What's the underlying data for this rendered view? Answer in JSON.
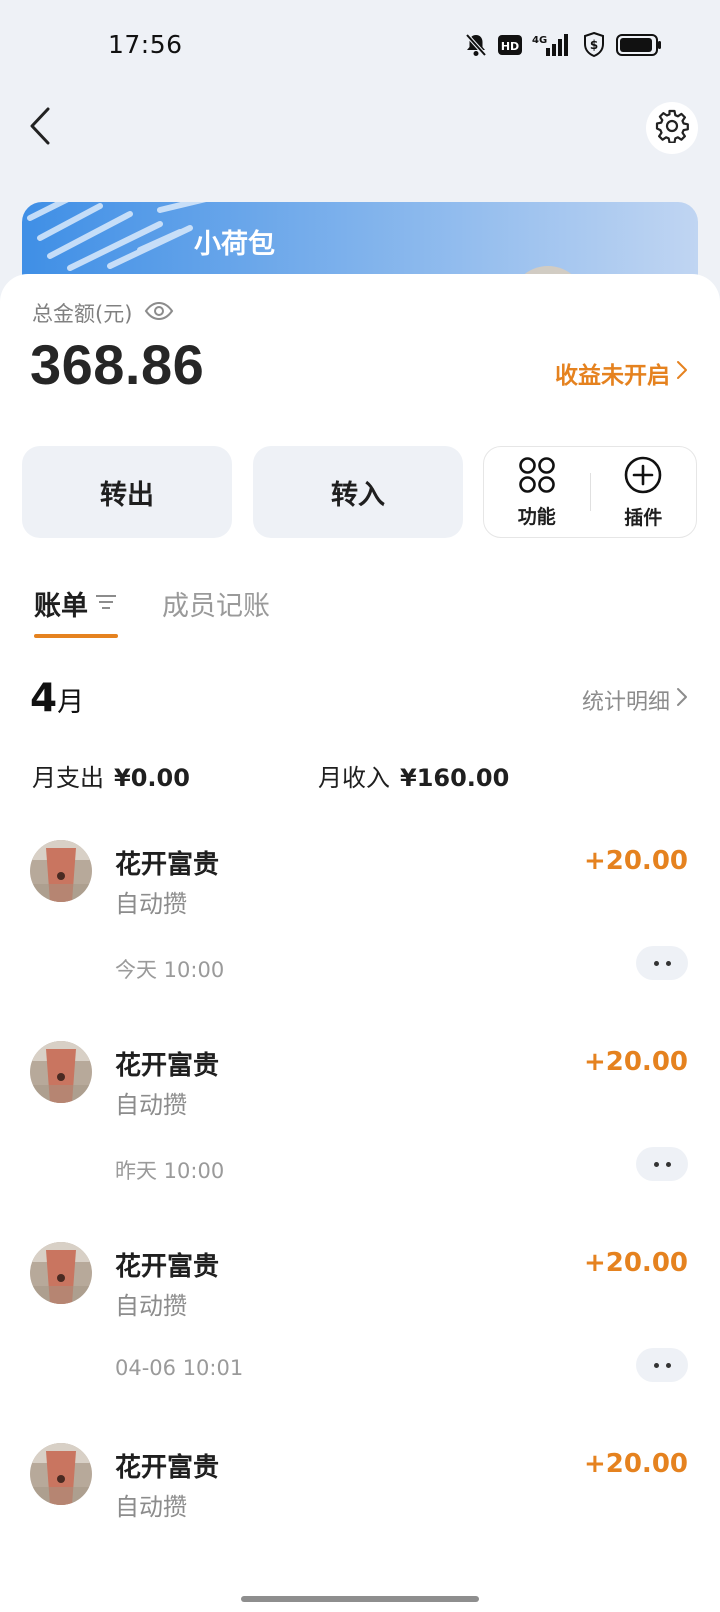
{
  "status_bar": {
    "time": "17:56",
    "network": "4G"
  },
  "header": {
    "back_icon": "chevron-left-icon",
    "settings_icon": "gear-icon"
  },
  "wallet": {
    "name": "小荷包"
  },
  "balance": {
    "label": "总金额(元)",
    "amount": "368.86",
    "earnings_link": "收益未开启"
  },
  "actions": {
    "transfer_out": "转出",
    "transfer_in": "转入",
    "functions": "功能",
    "plugins": "插件"
  },
  "tabs": {
    "bills": "账单",
    "members": "成员记账"
  },
  "month": {
    "number": "4",
    "unit": "月",
    "stats_link": "统计明细",
    "expense_label": "月支出",
    "expense_value": "¥0.00",
    "income_label": "月收入",
    "income_value": "¥160.00"
  },
  "bills": [
    {
      "title": "花开富贵",
      "subtitle": "自动攒",
      "amount": "+20.00",
      "time": "今天 10:00"
    },
    {
      "title": "花开富贵",
      "subtitle": "自动攒",
      "amount": "+20.00",
      "time": "昨天 10:00"
    },
    {
      "title": "花开富贵",
      "subtitle": "自动攒",
      "amount": "+20.00",
      "time": "04-06 10:01"
    },
    {
      "title": "花开富贵",
      "subtitle": "自动攒",
      "amount": "+20.00",
      "time": ""
    }
  ],
  "colors": {
    "accent": "#e5821f",
    "background": "#eef1f6",
    "card": "#4a94e6"
  }
}
